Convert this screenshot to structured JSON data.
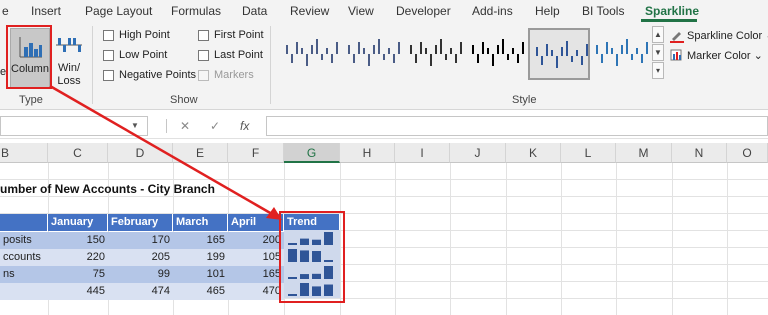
{
  "tabs": [
    "e",
    "Insert",
    "Page Layout",
    "Formulas",
    "Data",
    "Review",
    "View",
    "Developer",
    "Add-ins",
    "Help",
    "BI Tools",
    "Sparkline"
  ],
  "active_tab": "Sparkline",
  "ribbon": {
    "type_group": {
      "label": "Type",
      "column_label": "Column",
      "winloss_label_1": "Win/",
      "winloss_label_2": "Loss",
      "line_label_partial": "e"
    },
    "show_group": {
      "label": "Show",
      "high_point": "High Point",
      "low_point": "Low Point",
      "negative_points": "Negative Points",
      "first_point": "First Point",
      "last_point": "Last Point",
      "markers": "Markers"
    },
    "style_group": {
      "label": "Style",
      "selected_index": 4
    },
    "sparkline_color": "Sparkline Color",
    "marker_color": "Marker Color",
    "dropdown_glyph": "⌄"
  },
  "formula_bar": {
    "cancel_icon": "✕",
    "enter_icon": "✓",
    "fx_icon": "fx",
    "name_value": "",
    "formula_value": ""
  },
  "columns": [
    "B",
    "C",
    "D",
    "E",
    "F",
    "G",
    "H",
    "I",
    "J",
    "K",
    "L",
    "M",
    "N",
    "O"
  ],
  "selected_column": "G",
  "sheet": {
    "title": "umber of New Accounts - City Branch",
    "headers": {
      "b": "",
      "jan": "January",
      "feb": "February",
      "mar": "March",
      "apr": "April",
      "trend": "Trend"
    },
    "rows": [
      {
        "label": "posits",
        "jan": "150",
        "feb": "170",
        "mar": "165",
        "apr": "200"
      },
      {
        "label": "ccounts",
        "jan": "220",
        "feb": "205",
        "mar": "199",
        "apr": "105"
      },
      {
        "label": "ns",
        "jan": "75",
        "feb": "99",
        "mar": "101",
        "apr": "165"
      },
      {
        "label": "",
        "jan": "445",
        "feb": "474",
        "mar": "465",
        "apr": "470"
      }
    ],
    "sparklines": [
      [
        150,
        170,
        165,
        200
      ],
      [
        220,
        205,
        199,
        105
      ],
      [
        75,
        99,
        101,
        165
      ],
      [
        445,
        474,
        465,
        470
      ]
    ]
  },
  "colors": {
    "accent_green": "#217346",
    "table_header": "#4472c4",
    "band_dark": "#b4c6e7",
    "band_light": "#d9e1f2",
    "sparkline": "#2f5597",
    "annotation_red": "#e02020"
  }
}
